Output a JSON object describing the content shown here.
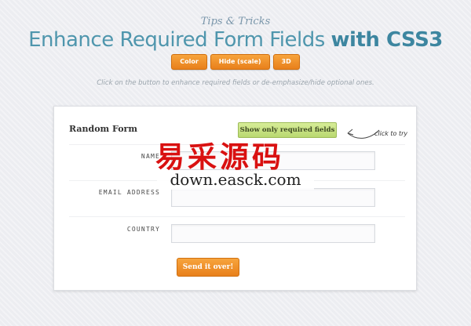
{
  "header": {
    "subtitle": "Tips & Tricks",
    "title_main": "Enhance Required Form Fields ",
    "title_bold": "with CSS3"
  },
  "demo_buttons": [
    "Color",
    "Hide (scale)",
    "3D"
  ],
  "hint": "Click on the button to enhance required fields or de-emphasize/hide optional ones.",
  "form": {
    "title": "Random Form",
    "toggle_label": "Show only required fields",
    "click_note": "click to try",
    "fields": [
      {
        "label": "NAME",
        "value": ""
      },
      {
        "label": "EMAIL ADDRESS",
        "value": ""
      },
      {
        "label": "COUNTRY",
        "value": ""
      }
    ],
    "submit_label": "Send it over!"
  },
  "watermark": {
    "chinese": "易采源码",
    "url": "down.easck.com"
  },
  "colors": {
    "title": "#4f96ad",
    "accent_orange": "#f08c24",
    "toggle_green": "#c6e283",
    "watermark_red": "#d91111"
  }
}
